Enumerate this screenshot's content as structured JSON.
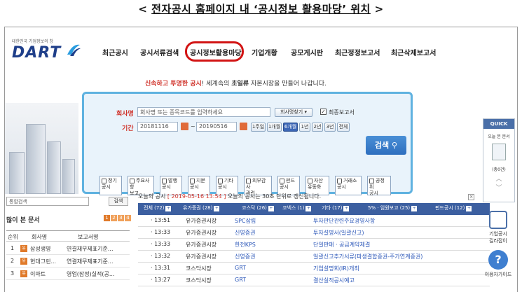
{
  "caption": {
    "prefix": "< ",
    "main": "전자공시 홈페이지 내 ‘공시정보 활용마당’ 위치",
    "suffix": " >"
  },
  "header": {
    "logo_sub": "대한민국 기업정보의 창",
    "logo": "DART",
    "nav": [
      "최근공시",
      "공시서류검색",
      "공시정보활용마당",
      "기업개황",
      "공모게시판",
      "최근정정보고서",
      "최근삭제보고서"
    ],
    "highlight_color": "#d21414"
  },
  "slogan": {
    "red": "신속하고 투명한 공시",
    "mid": "! 세계속의 ",
    "bold": "초일류",
    "end": " 자본시장을 만들어 나갑니다."
  },
  "search": {
    "company_label": "회사명",
    "company_placeholder": "회사명 또는 종목코드를 입력하세요",
    "company_list_btn": "회사명찾기 ▾",
    "final_report": "최종보고서",
    "period_label": "기간",
    "date_from": "20181116",
    "date_to": "20190516",
    "periods": [
      "1주일",
      "1개월",
      "6개월",
      "1년",
      "2년",
      "3년",
      "전체"
    ],
    "active_period": "6개월",
    "button": "검색",
    "categories": [
      [
        "정기",
        "공시"
      ],
      [
        "주요사항",
        "보고"
      ],
      [
        "발행",
        "공시"
      ],
      [
        "지분",
        "공시"
      ],
      [
        "기타",
        "공시"
      ],
      [
        "외부감사",
        "관련"
      ],
      [
        "펀드",
        "공시"
      ],
      [
        "자산",
        "유동화"
      ],
      [
        "거래소",
        "공시"
      ],
      [
        "공정위",
        "공시"
      ]
    ]
  },
  "quick": {
    "title": "QUICK",
    "item1": "오늘 본 문서",
    "count": "(총0건)"
  },
  "left": {
    "search_input": "통합검색",
    "search_btn": "검색",
    "title": "많이 본 문서",
    "pages": [
      "1",
      "2",
      "3",
      "4"
    ],
    "headers": [
      "순위",
      "회사명",
      "보고서명"
    ],
    "rows": [
      {
        "rank": "1",
        "tag": "유",
        "company": "삼성생명",
        "report": "연결재무제표기준..."
      },
      {
        "rank": "2",
        "tag": "유",
        "company": "현대그린...",
        "report": "연결재무제표기준..."
      },
      {
        "rank": "3",
        "tag": "유",
        "company": "이마트",
        "report": "영업(잠정)실적(공..."
      }
    ]
  },
  "today": {
    "prefix": "오늘의 공시",
    "date": "[ 2019-05-16 13:54 ]",
    "suffix": "오늘의 공시는 30초 단위로 갱신됩니다."
  },
  "tabs": [
    "전체 (72)",
    "유가증권 (28)",
    "코스닥 (26)",
    "코넥스 (1)",
    "기타 (17)",
    "5% · 임원보고 (25)",
    "펀드공시 (12)"
  ],
  "rows": [
    {
      "time": "13:51",
      "market": "유가증권시장",
      "company": "SPC삼립",
      "report": "투자판단관련주요경영사항"
    },
    {
      "time": "13:33",
      "market": "유가증권시장",
      "company": "신영증권",
      "report": "투자설명서(일괄신고)"
    },
    {
      "time": "13:33",
      "market": "유가증권시장",
      "company": "한전KPS",
      "report": "단일판매 · 공급계약체결"
    },
    {
      "time": "13:32",
      "market": "유가증권시장",
      "company": "신영증권",
      "report": "일괄신고추가서류(파생결합증권-주가연계증권)"
    },
    {
      "time": "13:31",
      "market": "코스닥시장",
      "company": "GRT",
      "report": "기업설명회(IR)개최"
    },
    {
      "time": "13:27",
      "market": "코스닥시장",
      "company": "GRT",
      "report": "결산실적공시예고"
    }
  ],
  "side": {
    "guide1": "기업공시",
    "guide2": "길라잡이",
    "help": "이용자가이드"
  }
}
